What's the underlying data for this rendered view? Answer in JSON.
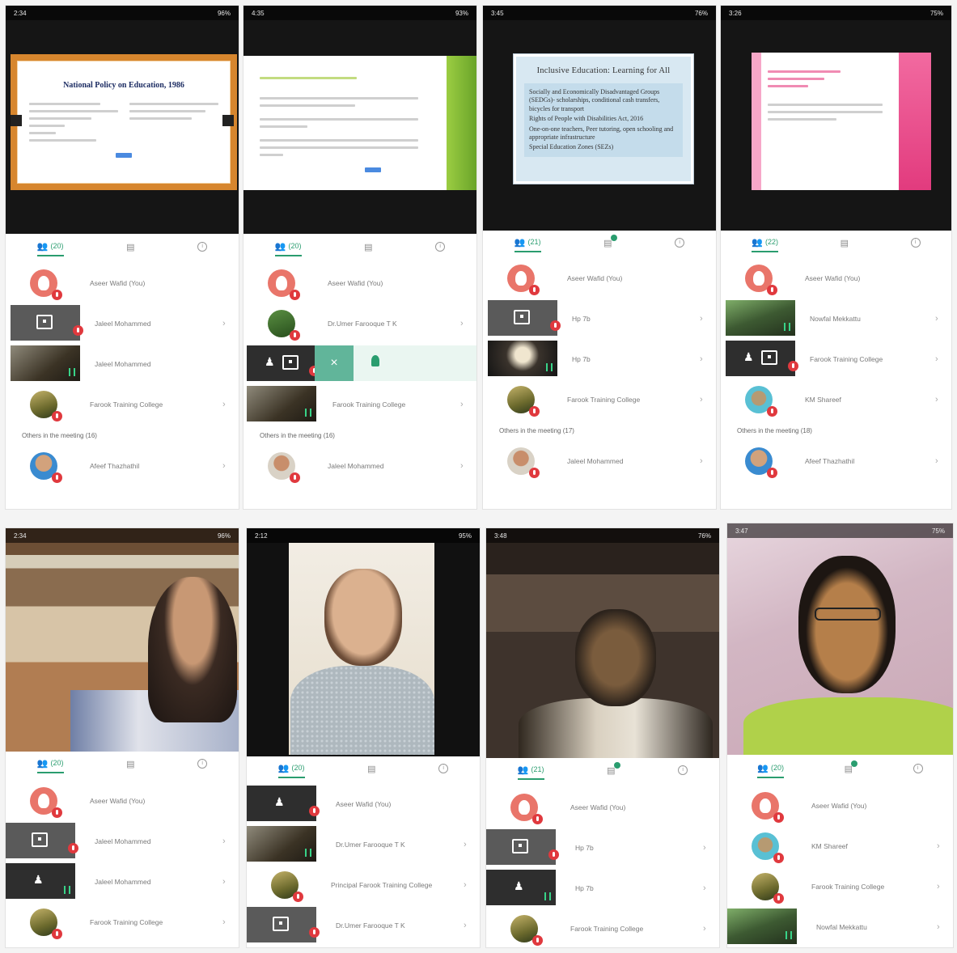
{
  "status": {
    "p1": {
      "time": "2:34",
      "battery": "96%"
    },
    "p2": {
      "time": "4:35",
      "battery": "93%"
    },
    "p3": {
      "time": "3:45",
      "battery": "76%"
    },
    "p4": {
      "time": "3:26",
      "battery": "75%"
    },
    "p5": {
      "time": "2:34",
      "battery": "96%"
    },
    "p6": {
      "time": "2:12",
      "battery": "95%"
    },
    "p7": {
      "time": "3:48",
      "battery": "76%"
    },
    "p8": {
      "time": "3:47",
      "battery": "75%"
    }
  },
  "slides": {
    "s1_title": "National Policy on Education, 1986",
    "s3_title": "Inclusive Education: Learning for All",
    "s3_bullets": [
      "Socially and Economically Disadvantaged Groups (SEDGs)- scholarships, conditional cash transfers, bicycles for transport",
      "Rights of People with Disabilities Act, 2016",
      "One-on-one teachers, Peer tutoring, open schooling and appropriate infrastructure",
      "Special Education Zones (SEZs)"
    ]
  },
  "tabs": {
    "p1": "(20)",
    "p2": "(20)",
    "p3": "(21)",
    "p4": "(22)",
    "p5": "(20)",
    "p6": "(20)",
    "p7": "(21)",
    "p8": "(20)"
  },
  "panels": {
    "p1": {
      "rows": [
        "Aseer Wafid (You)",
        "Jaleel Mohammed",
        "Jaleel Mohammed",
        "Farook Training College"
      ],
      "others": "Others in the meeting (16)",
      "others_rows": [
        "Afeef Thazhathil"
      ]
    },
    "p2": {
      "rows": [
        "Aseer Wafid (You)",
        "Dr.Umer Farooque T K",
        "",
        "Farook Training College"
      ],
      "others": "Others in the meeting (16)",
      "others_rows": [
        "Jaleel Mohammed"
      ]
    },
    "p3": {
      "rows": [
        "Aseer Wafid (You)",
        "Hp 7b",
        "Hp 7b",
        "Farook Training College"
      ],
      "others": "Others in the meeting (17)",
      "others_rows": [
        "Jaleel Mohammed"
      ]
    },
    "p4": {
      "rows": [
        "Aseer Wafid (You)",
        "Nowfal Mekkattu",
        "Farook Training College",
        "KM Shareef"
      ],
      "others": "Others in the meeting (18)",
      "others_rows": [
        "Afeef Thazhathil"
      ]
    },
    "p5": {
      "rows": [
        "Aseer Wafid (You)",
        "Jaleel Mohammed",
        "Jaleel Mohammed",
        "Farook Training College"
      ]
    },
    "p6": {
      "rows": [
        "Aseer Wafid (You)",
        "Dr.Umer Farooque T K",
        "Principal Farook Training College",
        "Dr.Umer Farooque T K"
      ]
    },
    "p7": {
      "rows": [
        "Aseer Wafid (You)",
        "Hp 7b",
        "Hp 7b",
        "Farook Training College"
      ]
    },
    "p8": {
      "rows": [
        "Aseer Wafid (You)",
        "KM Shareef",
        "Farook Training College",
        "Nowfal Mekkattu"
      ]
    }
  },
  "icons": {
    "people": "people-icon",
    "chat": "chat-icon",
    "info": "info-icon",
    "mic_off": "mic-off-icon",
    "share": "screen-share-icon",
    "bell": "pin-icon"
  },
  "colors": {
    "accent": "#2a9d6f",
    "mic_red": "#e0393e"
  }
}
